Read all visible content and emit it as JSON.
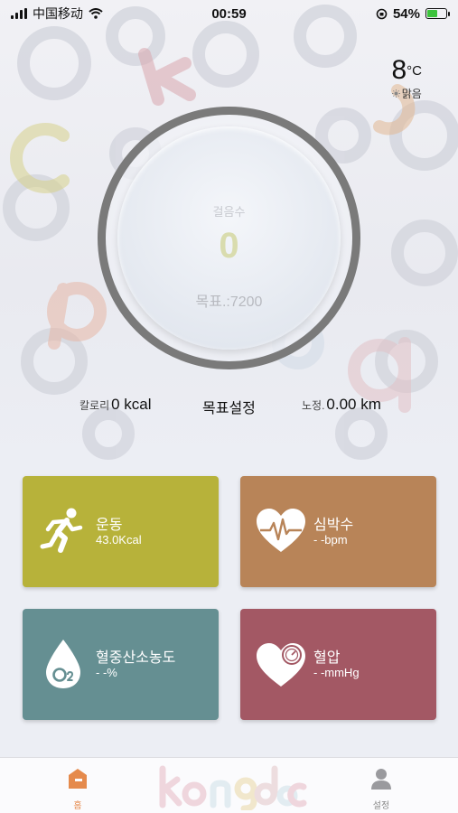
{
  "status_bar": {
    "carrier": "中国移动",
    "time": "00:59",
    "battery_percent": "54%",
    "battery_level": 0.54,
    "battery_color": "#3cc33c"
  },
  "weather": {
    "temperature": "8",
    "unit": "°C",
    "condition": "맑음",
    "icon": "sun-icon"
  },
  "steps": {
    "label": "걸음수",
    "value": "0",
    "goal_text": "목표.:7200"
  },
  "stats": {
    "calorie_label": "칼로리",
    "calorie_value": "0 kcal",
    "goal_button": "목표설정",
    "distance_label": "노정.",
    "distance_value": "0.00 km"
  },
  "cards": {
    "exercise": {
      "title": "운동",
      "value": "43.0Kcal",
      "icon": "running-person-icon",
      "color": "#b7b23a"
    },
    "heart_rate": {
      "title": "심박수",
      "value": "- -bpm",
      "icon": "heart-pulse-icon",
      "color": "#b88458"
    },
    "oxygen": {
      "title": "혈중산소농도",
      "value": "- -%",
      "icon": "o2-drop-icon",
      "color": "#658f92"
    },
    "blood_pressure": {
      "title": "혈압",
      "value": "- -mmHg",
      "icon": "heart-gauge-icon",
      "color": "#a35864"
    }
  },
  "tabbar": {
    "home_label": "홈",
    "settings_label": "설정",
    "brand": "kongdoc",
    "accent_color": "#e58a4c"
  }
}
